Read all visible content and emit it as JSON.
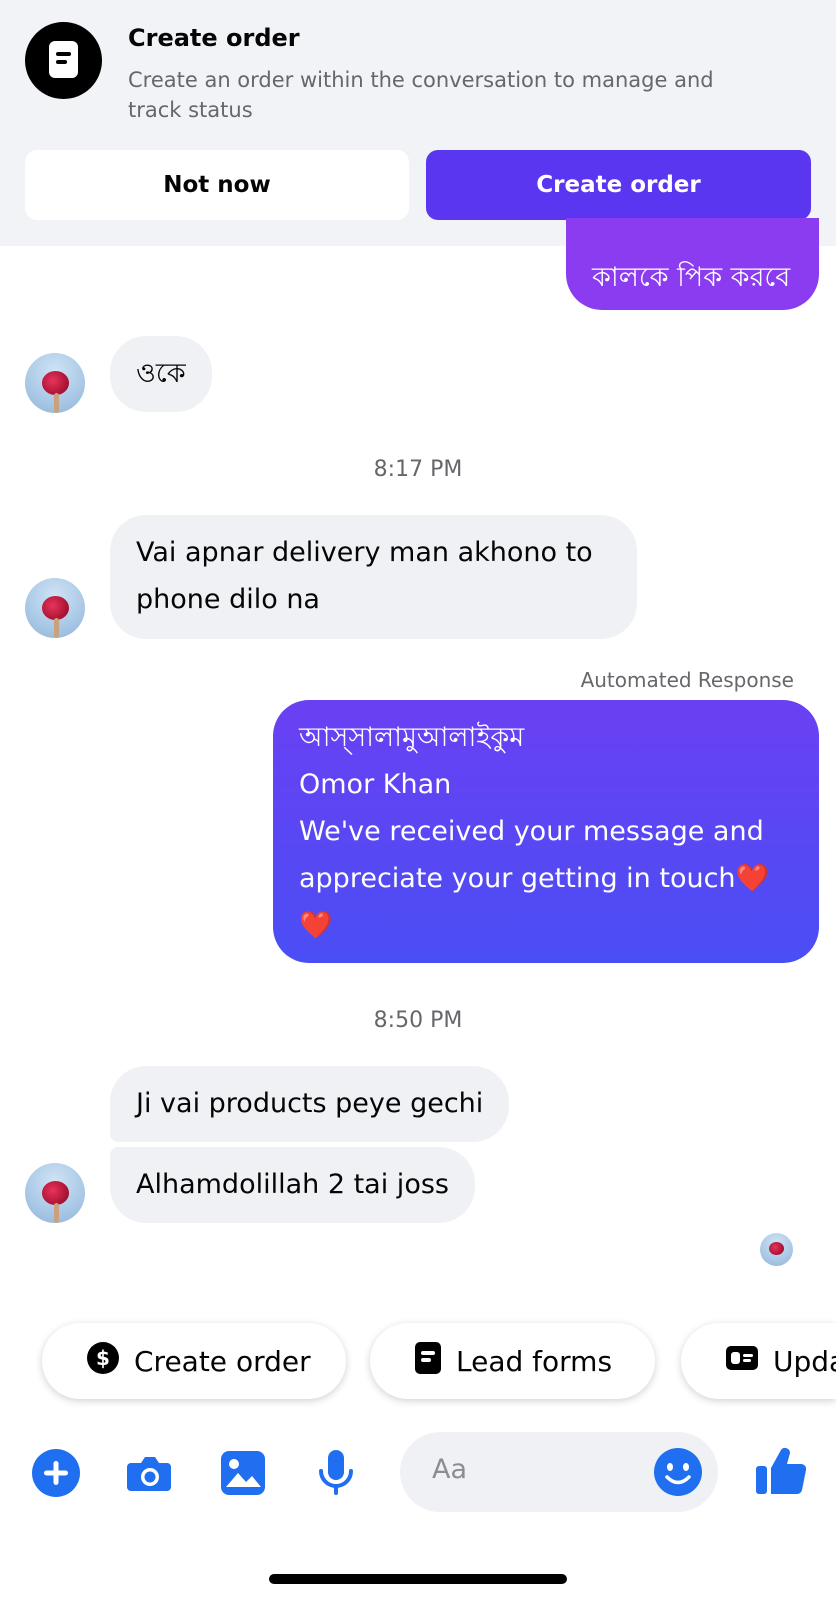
{
  "banner": {
    "title": "Create order",
    "description": "Create an order within the conversation to manage and track status",
    "secondary_button": "Not now",
    "primary_button": "Create order"
  },
  "messages": [
    {
      "from": "me",
      "text": "কালকে পিক করবে"
    },
    {
      "from": "them",
      "text": "ওকে"
    },
    {
      "type": "timestamp",
      "text": "8:17 PM"
    },
    {
      "from": "them",
      "text": "Vai apnar delivery man akhono to phone dilo na"
    },
    {
      "type": "label",
      "text": "Automated Response"
    },
    {
      "from": "me",
      "lines": [
        "আস্সালামুআলাইকুম",
        "Omor Khan",
        "We've received your message and appreciate your getting in touch❤️",
        "❤️"
      ]
    },
    {
      "type": "timestamp",
      "text": "8:50 PM"
    },
    {
      "from": "them",
      "text": "Ji vai products peye gechi"
    },
    {
      "from": "them",
      "text": "Alhamdolillah 2 tai joss"
    }
  ],
  "quick_replies": [
    {
      "label": "Create order",
      "icon": "dollar-circle-icon"
    },
    {
      "label": "Lead forms",
      "icon": "form-icon"
    },
    {
      "label": "Upda",
      "icon": "id-card-icon"
    }
  ],
  "composer": {
    "placeholder": "Aa",
    "icons": [
      "plus-icon",
      "camera-icon",
      "gallery-icon",
      "microphone-icon",
      "emoji-icon",
      "thumbs-up-icon"
    ]
  },
  "colors": {
    "primary": "#5b36f0",
    "outgoing_gradient_top": "#8d3cf1",
    "outgoing_gradient_bottom": "#4a4ef5",
    "icon_blue": "#1f6ff0"
  }
}
